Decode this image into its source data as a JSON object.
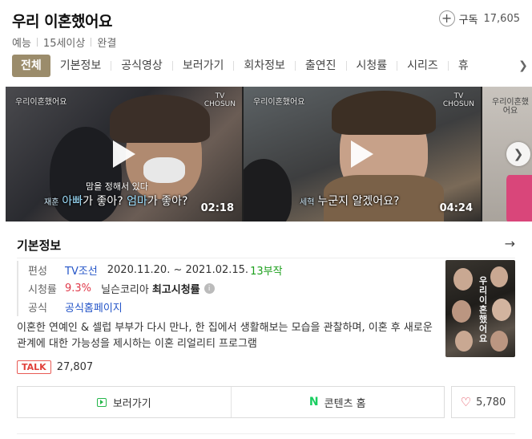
{
  "program": {
    "title": "우리 이혼했어요",
    "genre": "예능",
    "rating": "15세이상",
    "status": "완결"
  },
  "subscribe": {
    "label": "구독",
    "count": "17,605",
    "icon": "plus-circle-icon"
  },
  "tabs": [
    "전체",
    "기본정보",
    "공식영상",
    "보러가기",
    "회차정보",
    "출연진",
    "시청률",
    "시리즈",
    "휴"
  ],
  "active_tab": "전체",
  "videos": [
    {
      "duration": "02:18",
      "caption_top": "맘을 정해서 있다",
      "caption_speaker": "재훈",
      "caption_hl1": "아빠",
      "caption_mid": "가 좋아? ",
      "caption_hl2": "엄마",
      "caption_end": "가 좋아?",
      "logo_line1": "TV",
      "logo_line2": "CHOSUN",
      "show_mark": "우리이혼했어요"
    },
    {
      "duration": "04:24",
      "caption_speaker": "세혁",
      "caption_text": "누군지 알겠어요?",
      "logo_line1": "TV",
      "logo_line2": "CHOSUN",
      "show_mark": "우리이혼했어요"
    },
    {
      "show_mark": "우리이혼했어요"
    }
  ],
  "basic_info": {
    "section_title": "기본정보",
    "rows": {
      "channel_key": "편성",
      "channel": "TV조선",
      "period": "2020.11.20. ~ 2021.02.15.",
      "episodes": "13부작",
      "rating_key": "시청률",
      "rating_value": "9.3%",
      "rating_source": "닐슨코리아",
      "rating_label": "최고시청률",
      "official_key": "공식",
      "official_link": "공식홈페이지"
    },
    "poster_title": "우리이혼했어요",
    "description": "이혼한 연예인 & 셀럽 부부가 다시 만나, 한 집에서 생활해보는 모습을 관찰하며, 이혼 후 새로운 관계에 대한 가능성을 제시하는 이혼 리얼리티 프로그램",
    "talk_badge": "TALK",
    "talk_count": "27,807"
  },
  "actions": {
    "watch_label": "보러가기",
    "content_home_label": "콘텐츠 홈",
    "like_count": "5,780"
  },
  "colors": {
    "active_tab_bg": "#9b8c6b",
    "link": "#2455c8",
    "episodes_green": "#1da01d",
    "rating_red": "#e0394a",
    "naver_green": "#19ce60"
  }
}
